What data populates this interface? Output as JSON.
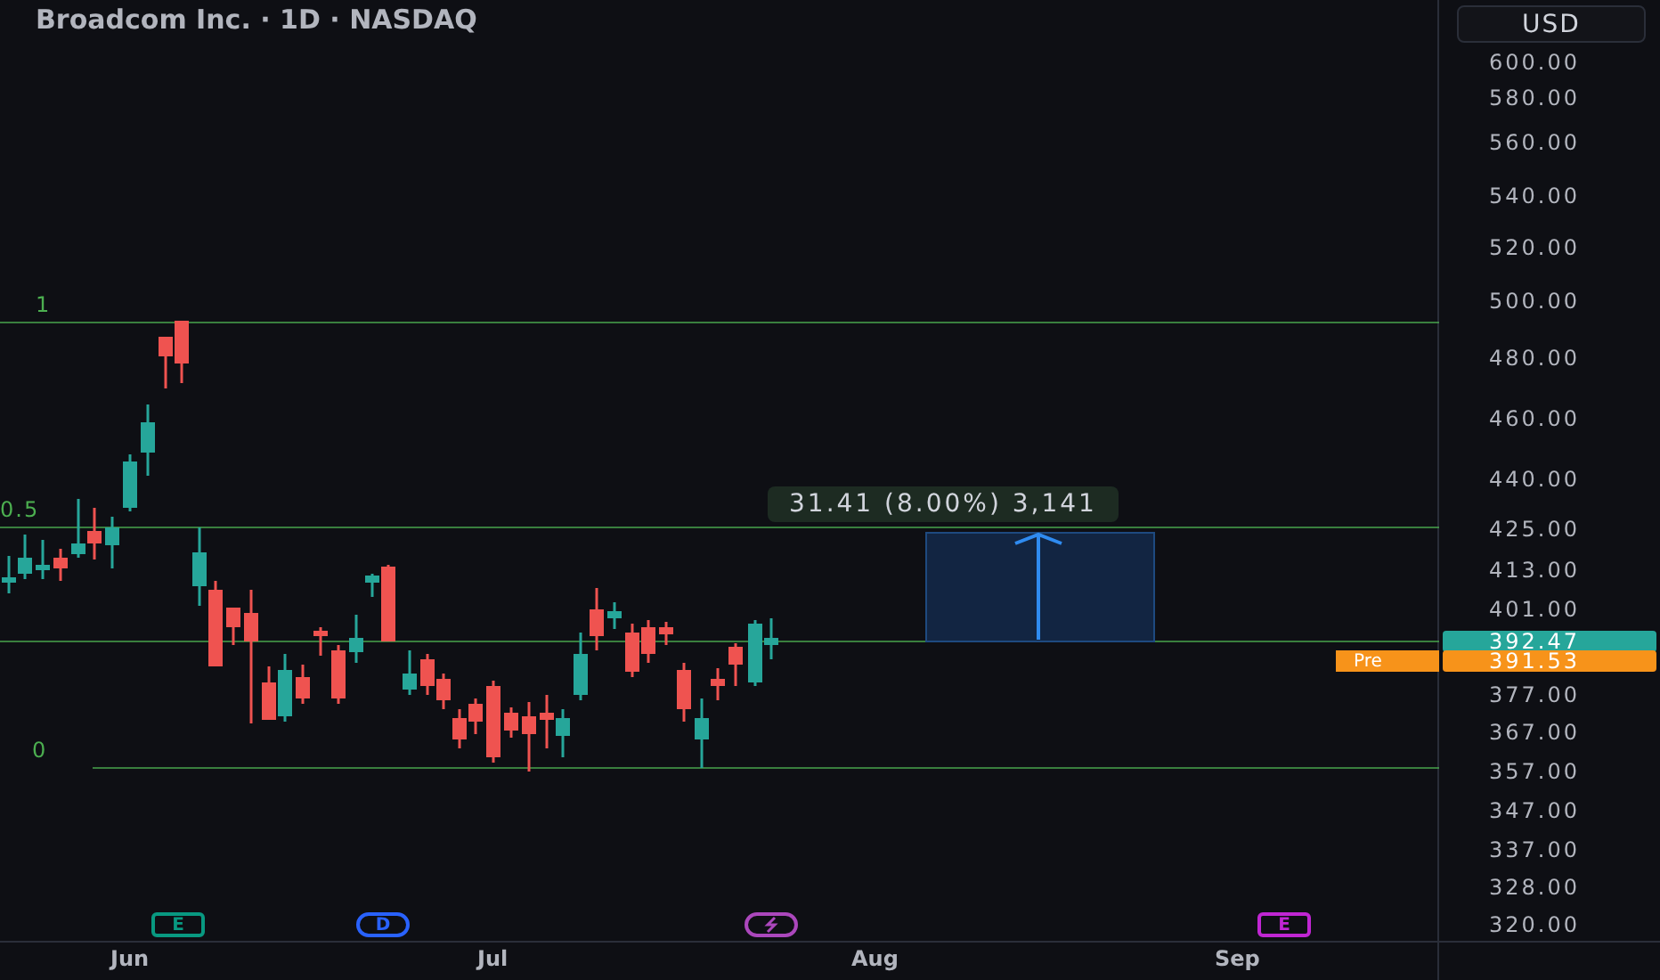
{
  "title": "Broadcom Inc. · 1D · NASDAQ",
  "currency_button": "USD",
  "price_axis": [
    "600.00",
    "580.00",
    "560.00",
    "540.00",
    "520.00",
    "500.00",
    "480.00",
    "460.00",
    "440.00",
    "425.00",
    "413.00",
    "401.00",
    "377.00",
    "367.00",
    "357.00",
    "347.00",
    "337.00",
    "328.00",
    "320.00"
  ],
  "price_tags": [
    {
      "kind": "last",
      "value": "392.47"
    },
    {
      "kind": "pre",
      "label": "Pre",
      "value": "391.53"
    }
  ],
  "fib_levels": [
    {
      "label": "1"
    },
    {
      "label": "0.5"
    },
    {
      "label": "0"
    }
  ],
  "measure": {
    "label": "31.41 (8.00%) 3,141"
  },
  "events": [
    {
      "kind": "earnings",
      "label": "E",
      "color": "#089981"
    },
    {
      "kind": "dividend",
      "label": "D",
      "color": "#2962ff"
    },
    {
      "kind": "split",
      "color": "#ab47bc"
    },
    {
      "kind": "earnings_group",
      "label": "E",
      "color": "#c026d3"
    }
  ],
  "time_axis": [
    "Jun",
    "Jul",
    "Aug",
    "Sep"
  ]
}
